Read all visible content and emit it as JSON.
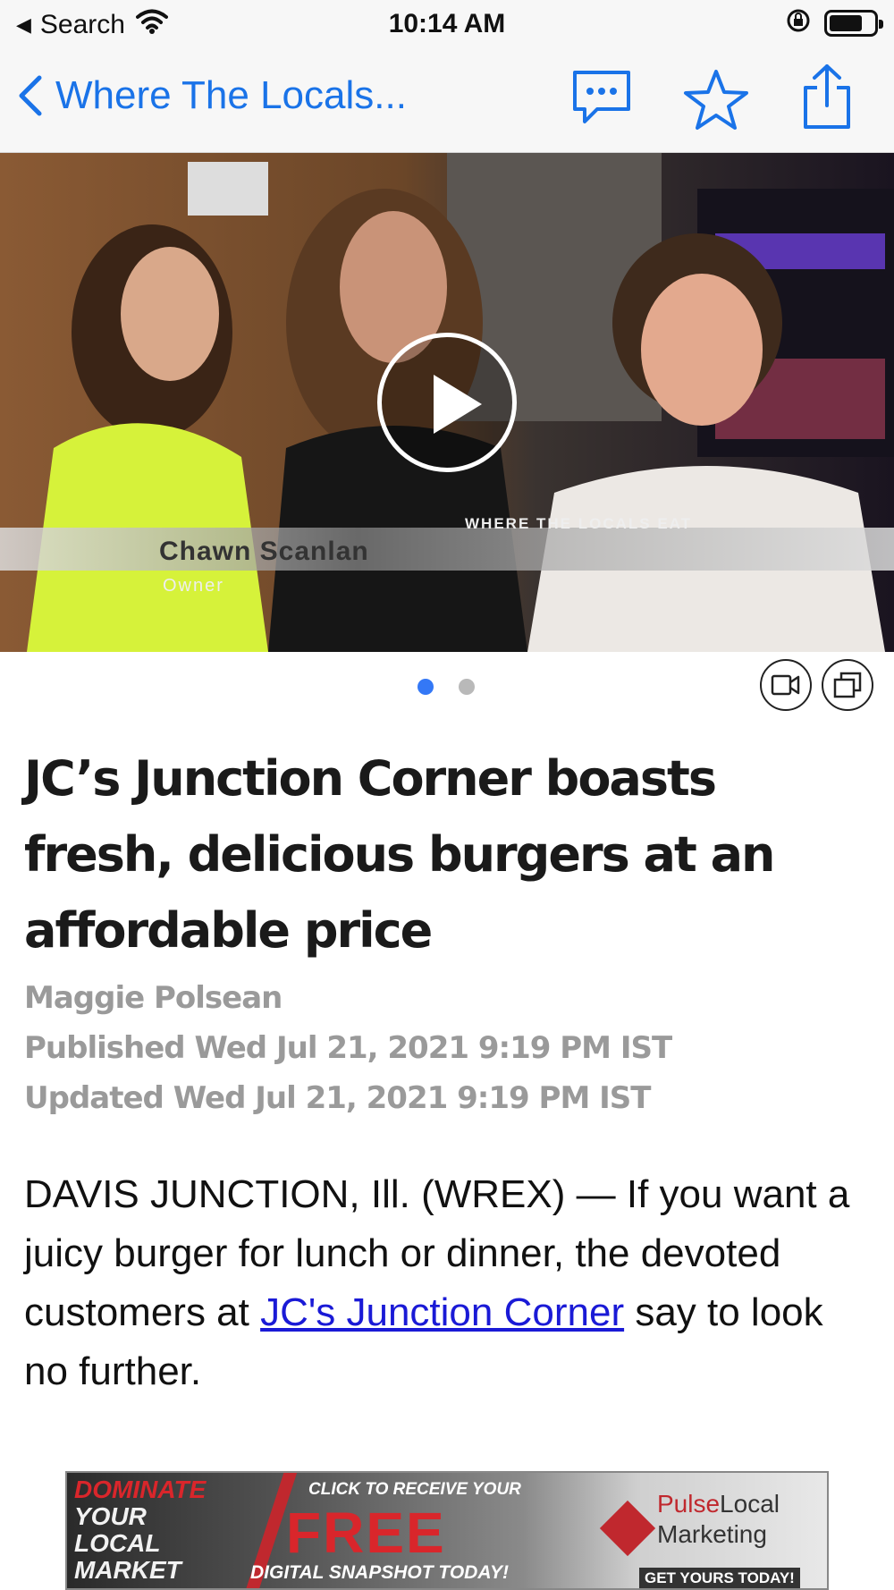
{
  "status_bar": {
    "back_app": "Search",
    "time": "10:14 AM",
    "battery_level": 0.75
  },
  "nav": {
    "back_title": "Where The Locals...",
    "icons": [
      "chevron-left-icon",
      "comments-icon",
      "star-icon",
      "share-icon"
    ]
  },
  "media": {
    "lower_third_name": "Chawn  Scanlan",
    "lower_third_role": "Owner",
    "show_name": "WHERE THE LOCALS EAT",
    "page_count": 2,
    "current_page": 1
  },
  "article": {
    "headline": "JC’s Junction Corner boasts fresh, delicious burgers at an affordable price",
    "author": "Maggie Polsean",
    "published": "Published Wed Jul 21, 2021 9:19 PM IST",
    "updated": "Updated Wed Jul 21, 2021 9:19 PM IST",
    "body_before_link": "DAVIS JUNCTION, Ill. (WREX) — If you want a juicy burger for lunch or dinner, the devoted customers at ",
    "body_link": "JC's Junction Corner",
    "body_after_link": " say to look no further."
  },
  "ad": {
    "line1": "DOMINATE",
    "line2": "YOUR",
    "line3": "LOCAL",
    "line4": "MARKET",
    "click_text": "CLICK TO RECEIVE YOUR",
    "free_text": "FREE",
    "snapshot_text": "DIGITAL SNAPSHOT TODAY!",
    "brand_part1": "Pulse",
    "brand_part2": "Local",
    "brand_line2": "Marketing",
    "cta": "GET YOURS TODAY!"
  },
  "colors": {
    "accent": "#1a73e8",
    "link": "#1a1ad6",
    "meta_gray": "#9a9a9a",
    "ad_red": "#d9262b"
  }
}
